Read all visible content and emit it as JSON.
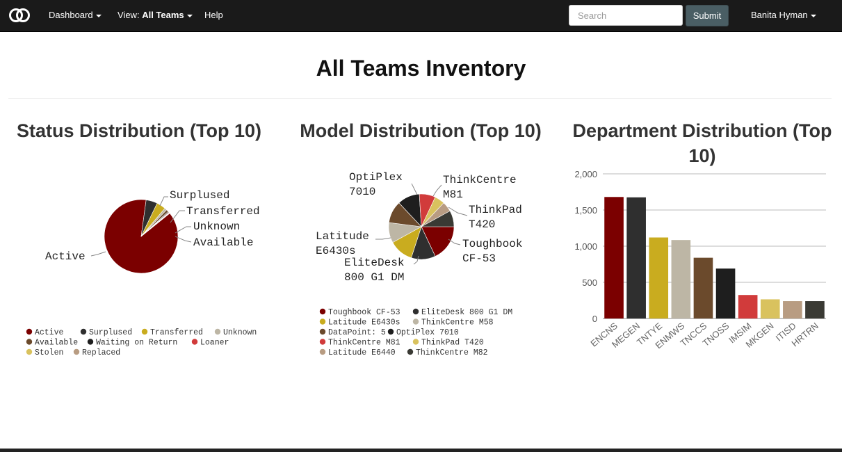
{
  "navbar": {
    "brand_icon": "rings-logo-icon",
    "dashboard_label": "Dashboard",
    "view_prefix": "View:",
    "view_value": "All Teams",
    "help_label": "Help",
    "search_placeholder": "Search",
    "submit_label": "Submit",
    "user_label": "Banita Hyman"
  },
  "page": {
    "title": "All Teams Inventory"
  },
  "colors": {
    "darkred": "#7b0000",
    "charcoal": "#2f2f2f",
    "gold": "#c9ac1f",
    "beige": "#bdb6a5",
    "brown": "#6b4a2c",
    "black": "#1e1e1e",
    "red": "#d13b3b",
    "lightgold": "#d9c25e",
    "tan": "#b89c82",
    "darkgray": "#3a3a34"
  },
  "status_chart": {
    "title": "Status Distribution (Top 10)",
    "chart_data": {
      "type": "pie",
      "slices": [
        {
          "label": "Active",
          "value": 88,
          "color": "#7b0000"
        },
        {
          "label": "Surplused",
          "value": 5,
          "color": "#2f2f2f"
        },
        {
          "label": "Transferred",
          "value": 4,
          "color": "#c9ac1f"
        },
        {
          "label": "Unknown",
          "value": 1,
          "color": "#bdb6a5"
        },
        {
          "label": "Available",
          "value": 1,
          "color": "#6b4a2c"
        },
        {
          "label": "Waiting on Return",
          "value": 0.4,
          "color": "#1e1e1e"
        },
        {
          "label": "Loaner",
          "value": 0.3,
          "color": "#d13b3b"
        },
        {
          "label": "Stolen",
          "value": 0.2,
          "color": "#d9c25e"
        },
        {
          "label": "Replaced",
          "value": 0.1,
          "color": "#b89c82"
        }
      ],
      "outer_labels": [
        "Active",
        "Surplused",
        "Transferred",
        "Unknown",
        "Available"
      ],
      "legend": [
        "Active",
        "Surplused",
        "Transferred",
        "Unknown",
        "Available",
        "Waiting on Return",
        "Loaner",
        "Stolen",
        "Replaced"
      ]
    }
  },
  "model_chart": {
    "title": "Model Distribution (Top 10)",
    "chart_data": {
      "type": "pie",
      "slices": [
        {
          "label": "Toughbook CF-53",
          "value": 18,
          "color": "#7b0000"
        },
        {
          "label": "EliteDesk 800 G1 DM",
          "value": 12,
          "color": "#2f2f2f"
        },
        {
          "label": "Latitude E6430s",
          "value": 12,
          "color": "#c9ac1f"
        },
        {
          "label": "ThinkCentre M58",
          "value": 10,
          "color": "#bdb6a5"
        },
        {
          "label": "DataPoint: 5",
          "value": 11,
          "color": "#6b4a2c"
        },
        {
          "label": "OptiPlex 7010",
          "value": 11,
          "color": "#1e1e1e"
        },
        {
          "label": "ThinkCentre M81",
          "value": 8,
          "color": "#d13b3b"
        },
        {
          "label": "ThinkPad T420",
          "value": 5,
          "color": "#d9c25e"
        },
        {
          "label": "Latitude E6440",
          "value": 5,
          "color": "#b89c82"
        },
        {
          "label": "ThinkCentre M82",
          "value": 8,
          "color": "#3a3a34"
        }
      ],
      "outer_labels": [
        "OptiPlex 7010",
        "ThinkCentre M81",
        "ThinkPad T420",
        "Toughbook CF-53",
        "EliteDesk 800 G1 DM",
        "Latitude E6430s"
      ],
      "legend": [
        "Toughbook CF-53",
        "EliteDesk 800 G1 DM",
        "Latitude E6430s",
        "ThinkCentre M58",
        "DataPoint: 5",
        "OptiPlex 7010",
        "ThinkCentre M81",
        "ThinkPad T420",
        "Latitude E6440",
        "ThinkCentre M82"
      ]
    }
  },
  "department_chart": {
    "title": "Department Distribution (Top 10)",
    "chart_data": {
      "type": "bar",
      "categories": [
        "ENCNS",
        "MEGEN",
        "TNTYE",
        "ENMWS",
        "TNCCS",
        "TNOSS",
        "IMSIM",
        "MKGEN",
        "ITISD",
        "HRTRN"
      ],
      "values": [
        1680,
        1675,
        1120,
        1085,
        840,
        690,
        325,
        265,
        240,
        240
      ],
      "colors": [
        "#7b0000",
        "#2f2f2f",
        "#c9ac1f",
        "#bdb6a5",
        "#6b4a2c",
        "#1e1e1e",
        "#d13b3b",
        "#d9c25e",
        "#b89c82",
        "#3a3a34"
      ],
      "ylim": [
        0,
        2000
      ],
      "yticks": [
        "0",
        "500",
        "1,000",
        "1,500",
        "2,000"
      ],
      "grid": true
    }
  }
}
